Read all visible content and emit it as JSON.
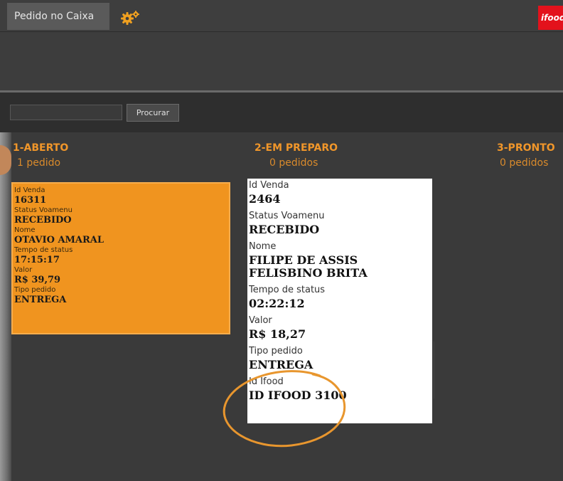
{
  "topbar": {
    "tab_label": "Pedido no Caixa",
    "gear_icon": "gear-icon",
    "logo_text": "ifood"
  },
  "search": {
    "value": "",
    "button_label": "Procurar"
  },
  "columns": [
    {
      "title": "1-ABERTO",
      "count": "1 pedido"
    },
    {
      "title": "2-EM PREPARO",
      "count": "0 pedidos"
    },
    {
      "title": "3-PRONTO",
      "count": "0 pedidos"
    }
  ],
  "card_open": {
    "id_label": "Id Venda",
    "id_value": "16311",
    "status_label": "Status Voamenu",
    "status_value": "RECEBIDO",
    "name_label": "Nome",
    "name_value": "OTAVIO AMARAL",
    "time_label": "Tempo de status",
    "time_value": "17:15:17",
    "value_label": "Valor",
    "value_value": "R$ 39,79",
    "type_label": "Tipo pedido",
    "type_value": "ENTREGA"
  },
  "card_prep": {
    "id_label": "Id Venda",
    "id_value": "2464",
    "status_label": "Status Voamenu",
    "status_value": "RECEBIDO",
    "name_label": "Nome",
    "name_value": "FILIPE DE ASSIS FELISBINO BRITA",
    "time_label": "Tempo de status",
    "time_value": "02:22:12",
    "value_label": "Valor",
    "value_value": "R$ 18,27",
    "type_label": "Tipo pedido",
    "type_value": "ENTREGA",
    "ifood_label": "Id Ifood",
    "ifood_value": "ID IFOOD 3100"
  },
  "colors": {
    "accent": "#f0941f",
    "highlight_circle": "#e8962e",
    "background": "#3a3a3a"
  }
}
